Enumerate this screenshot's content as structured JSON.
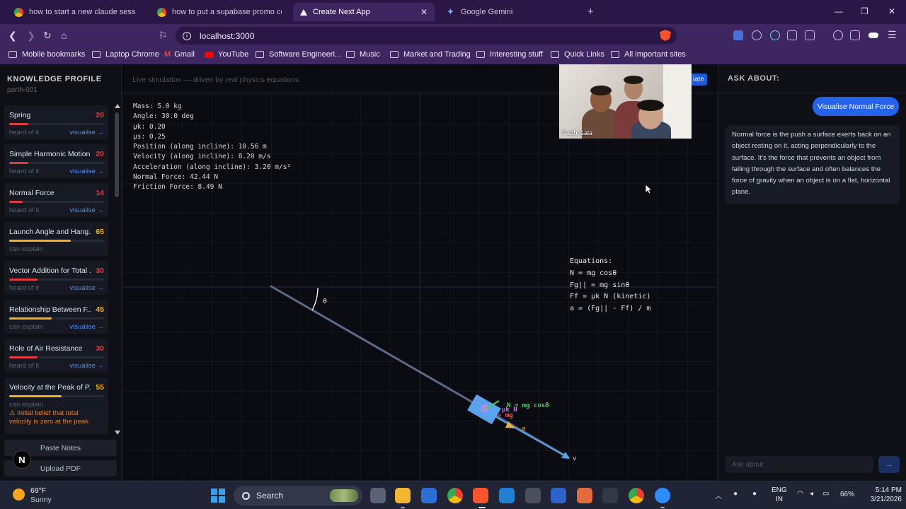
{
  "browser": {
    "tabs": [
      {
        "title": "how to start a new claude session an",
        "active": false
      },
      {
        "title": "how to put a supabase promo code t",
        "active": false
      },
      {
        "title": "Create Next App",
        "active": true
      },
      {
        "title": "Google Gemini",
        "active": false
      }
    ],
    "url": "localhost:3000",
    "bookmarks": [
      "Mobile bookmarks",
      "Laptop Chrome",
      "Gmail",
      "YouTube",
      "Software Engineeri...",
      "Music",
      "Market and Trading",
      "Interesting stuff",
      "Quick Links",
      "All important sites"
    ]
  },
  "sidebar": {
    "title": "KNOWLEDGE PROFILE",
    "subtitle": "parth-001",
    "cards": [
      {
        "name": "Spring",
        "score": "20",
        "status": "heard of it",
        "action": "visualise →",
        "progress": 0.2,
        "color": "#e23b3b"
      },
      {
        "name": "Simple Harmonic Motion",
        "score": "20",
        "status": "heard of it",
        "action": "visualise →",
        "progress": 0.2,
        "color": "#e23b3b"
      },
      {
        "name": "Normal Force",
        "score": "14",
        "status": "heard of it",
        "action": "visualise →",
        "progress": 0.14,
        "color": "#e23b3b"
      },
      {
        "name": "Launch Angle and Hang...",
        "score": "65",
        "status": "can explain",
        "action": "",
        "progress": 0.65,
        "color": "#f2b01e"
      },
      {
        "name": "Vector Addition for Total ...",
        "score": "30",
        "status": "heard of it",
        "action": "visualise →",
        "progress": 0.3,
        "color": "#e23b3b"
      },
      {
        "name": "Relationship Between F...",
        "score": "45",
        "status": "can explain",
        "action": "visualise →",
        "progress": 0.45,
        "color": "#f2b01e"
      },
      {
        "name": "Role of Air Resistance",
        "score": "30",
        "status": "heard of it",
        "action": "visualise →",
        "progress": 0.3,
        "color": "#e23b3b"
      },
      {
        "name": "Velocity at the Peak of P...",
        "score": "55",
        "status": "can explain",
        "action": "",
        "progress": 0.55,
        "color": "#f2b01e",
        "warning": "⚠ Initial belief that total velocity is zero at the peak"
      }
    ],
    "paste_notes": "Paste Notes",
    "upload_pdf": "Upload PDF"
  },
  "simulation": {
    "caption": "Live simulation — driven by real physics equations",
    "button_label": "iate",
    "readout": [
      "Mass: 5.0 kg",
      "Angle: 30.0 deg",
      "μk: 0.20",
      "μs: 0.25",
      "Position (along incline): 10.56 m",
      "Velocity (along incline): 8.20 m/s",
      "Acceleration (along incline): 3.20 m/s²",
      "Normal Force: 42.44 N",
      "Friction Force: 8.49 N"
    ],
    "equations_title": "Equations:",
    "equations": [
      "N = mg cosθ",
      "Fg|| = mg sinθ",
      "Ff = μk N (kinetic)",
      "a = (Fg|| - Ff) / m"
    ],
    "angle_label": "θ",
    "force_labels": [
      "N = mg cosθ",
      "μk N",
      "= mg"
    ],
    "acc_label": "a",
    "vel_label": "v",
    "colors": {
      "incline": "#5b6a8a",
      "block": "#5aa2ee",
      "velocity": "#5aa2ee",
      "normal": "#4fcf6a",
      "friction": "#c970e0",
      "gravity": "#ef5d5d",
      "acceleration": "#e8b04a"
    }
  },
  "webcam": {
    "name": "Parth Gala"
  },
  "right_panel": {
    "title": "ASK ABOUT:",
    "user_message": "Visualise Normal Force",
    "bot_message": "Normal force is the push a surface exerts back on an object resting on it, acting perpendicularly to the surface. It's the force that prevents an object from falling through the surface and often balances the force of gravity when an object is on a flat, horizontal plane.",
    "input_placeholder": "Ask about",
    "send_icon": "→"
  },
  "taskbar": {
    "temperature": "69°F",
    "weather": "Sunny",
    "search": "Search",
    "lang_line1": "ENG",
    "lang_line2": "IN",
    "battery": "66%",
    "time": "5:14 PM",
    "date": "3/21/2026"
  }
}
